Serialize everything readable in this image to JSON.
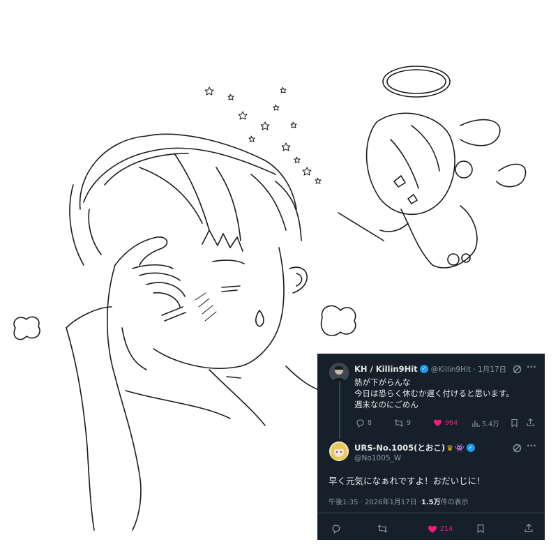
{
  "tweet": {
    "author_name": "KH / Killin9Hit",
    "handle_time": "@Killin9Hit · 1月17日",
    "lines": [
      "熱が下がらんな",
      "今日は恐らく休むか遅く付けると思います。",
      "週末なのにごめん"
    ],
    "replies": "8",
    "retweets": "9",
    "likes": "964",
    "views": "5.4万"
  },
  "reply": {
    "author_name": "URS-No.1005(とおこ)",
    "handle": "@No1005_W",
    "text": "早く元気になぁれですよ！おだいじに！",
    "meta_time": "午後1:35 · 2026年1月17日 · ",
    "meta_views": "1.5万",
    "meta_views_suffix": " 件の表示",
    "likes": "214"
  },
  "colors": {
    "background": "#15202b",
    "text": "#e7e9ea",
    "secondary": "#8b98a5",
    "like_pink": "#f91880",
    "verified_blue": "#1d9bf0"
  },
  "icons": [
    "verified-icon",
    "grok-icon",
    "more-icon",
    "reply-icon",
    "retweet-icon",
    "like-icon",
    "views-icon",
    "bookmark-icon",
    "share-icon",
    "crown-emoji-icon",
    "alien-emoji-icon"
  ]
}
